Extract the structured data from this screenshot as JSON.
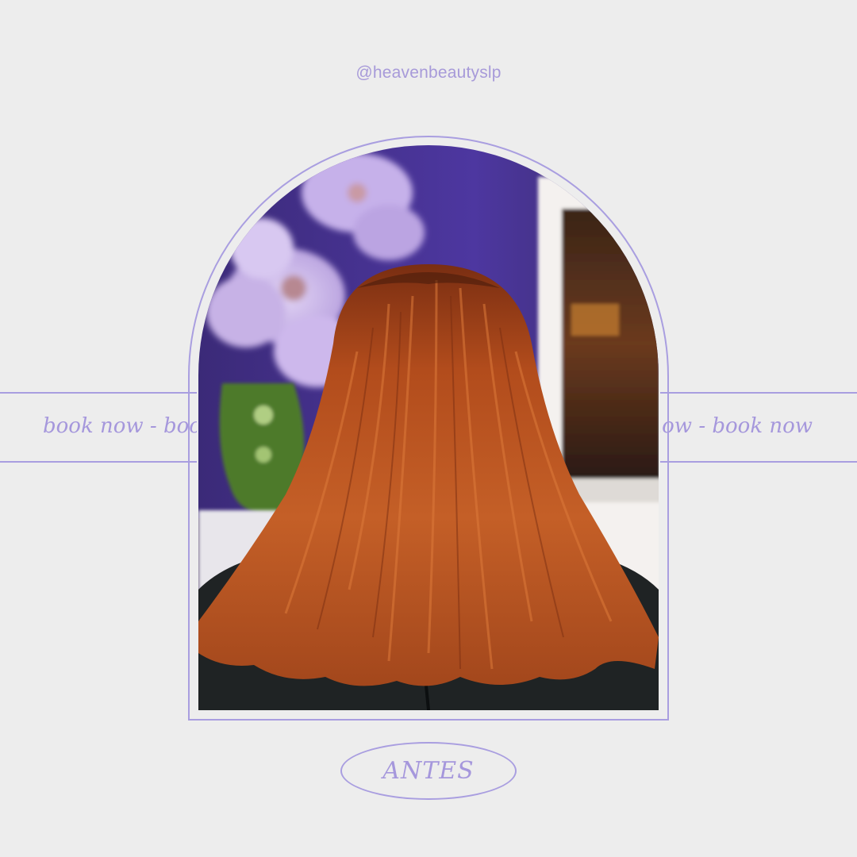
{
  "post": {
    "handle": "@heavenbeautyslp",
    "ticker_left": "book now  -  book now",
    "ticker_right": "book now - book now",
    "label": "ANTES"
  },
  "photo": {
    "subject": "back view of shoulder-length copper red hair",
    "accent_color": "#a99ee0",
    "hair_color": "#b3531f",
    "background_color": "#ededed"
  }
}
